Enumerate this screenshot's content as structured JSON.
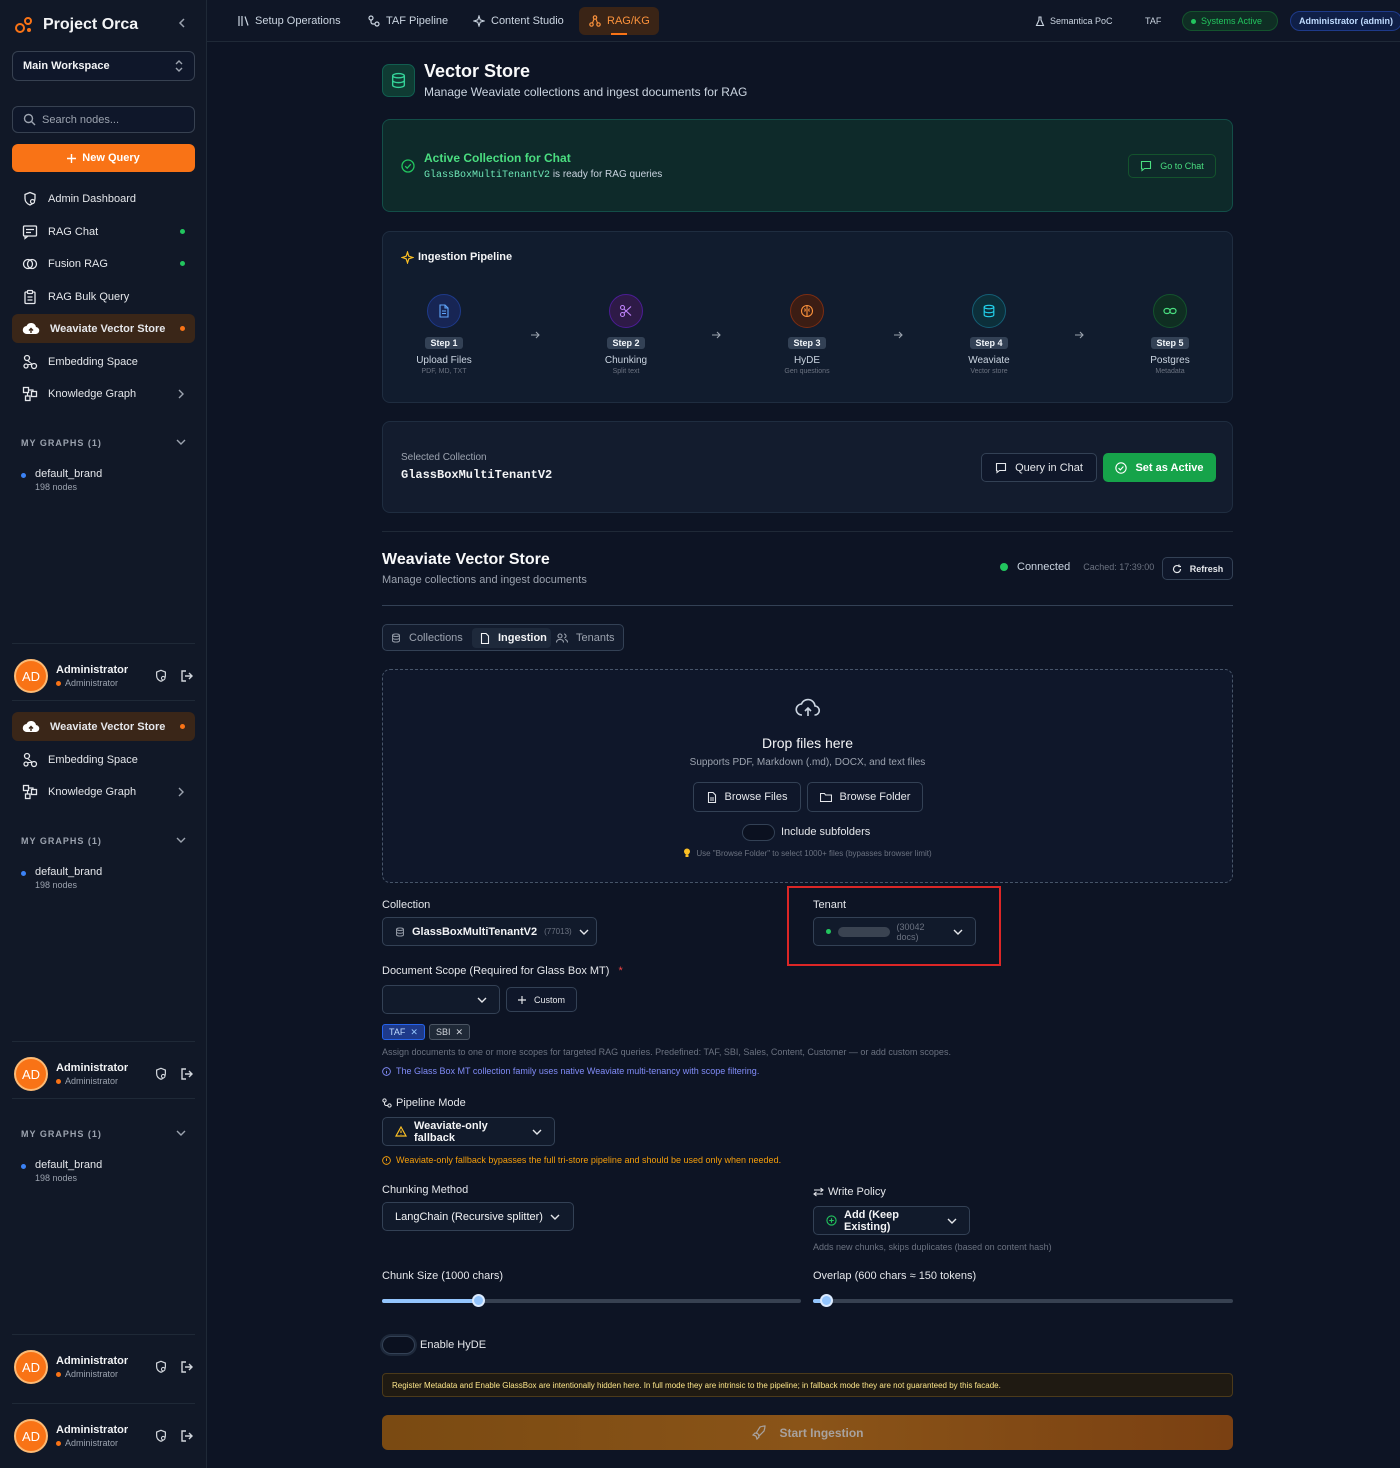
{
  "sidebar": {
    "brand": "Project Orca",
    "workspace": "Main Workspace",
    "search_placeholder": "Search nodes...",
    "new_query": "New Query",
    "nav": [
      "Admin Dashboard",
      "RAG Chat",
      "Fusion RAG",
      "RAG Bulk Query",
      "Weaviate Vector Store",
      "Embedding Space",
      "Knowledge Graph"
    ],
    "my_graphs": "MY GRAPHS (1)",
    "graph": {
      "name": "default_brand",
      "count": "198 nodes"
    },
    "user": {
      "initials": "AD",
      "name": "Administrator",
      "role": "Administrator"
    }
  },
  "topbar": {
    "nav": [
      "Setup Operations",
      "TAF Pipeline",
      "Content Studio",
      "RAG/KG"
    ],
    "right": {
      "project": "Semantica PoC",
      "env": "TAF",
      "status": "Systems Active",
      "user": "Administrator (admin)"
    }
  },
  "header": {
    "title": "Vector Store",
    "subtitle": "Manage Weaviate collections and ingest documents for RAG"
  },
  "active": {
    "title": "Active Collection for Chat",
    "collection": "GlassBoxMultiTenantV2",
    "suffix": "is ready for RAG queries",
    "button": "Go to Chat"
  },
  "pipeline": {
    "title": "Ingestion Pipeline",
    "steps": [
      {
        "badge": "Step 1",
        "name": "Upload Files",
        "sub": "PDF, MD, TXT"
      },
      {
        "badge": "Step 2",
        "name": "Chunking",
        "sub": "Split text"
      },
      {
        "badge": "Step 3",
        "name": "HyDE",
        "sub": "Gen questions"
      },
      {
        "badge": "Step 4",
        "name": "Weaviate",
        "sub": "Vector store"
      },
      {
        "badge": "Step 5",
        "name": "Postgres",
        "sub": "Metadata"
      }
    ]
  },
  "selected": {
    "label": "Selected Collection",
    "name": "GlassBoxMultiTenantV2",
    "query_btn": "Query in Chat",
    "active_btn": "Set as Active"
  },
  "store": {
    "title": "Weaviate Vector Store",
    "subtitle": "Manage collections and ingest documents",
    "status": "Connected",
    "cached": "Cached: 17:39:00",
    "refresh": "Refresh"
  },
  "tabs": [
    "Collections",
    "Ingestion",
    "Tenants"
  ],
  "drop": {
    "title": "Drop files here",
    "sub": "Supports PDF, Markdown (.md), DOCX, and text files",
    "browse_files": "Browse Files",
    "browse_folder": "Browse Folder",
    "subfolders": "Include subfolders",
    "hint": "Use \"Browse Folder\" to select 1000+ files (bypasses browser limit)"
  },
  "collection": {
    "label": "Collection",
    "value": "GlassBoxMultiTenantV2",
    "count": "(77013)"
  },
  "tenant": {
    "label": "Tenant",
    "count": "(30042 docs)"
  },
  "scope": {
    "label": "Document Scope (Required for Glass Box MT)",
    "required": "*",
    "custom": "Custom",
    "tags": [
      "TAF",
      "SBI"
    ],
    "help": "Assign documents to one or more scopes for targeted RAG queries. Predefined: TAF, SBI, Sales, Content, Customer — or add custom scopes.",
    "info": "The Glass Box MT collection family uses native Weaviate multi-tenancy with scope filtering."
  },
  "pipeline_mode": {
    "label": "Pipeline Mode",
    "value": "Weaviate-only fallback",
    "warning": "Weaviate-only fallback bypasses the full tri-store pipeline and should be used only when needed."
  },
  "chunking": {
    "label": "Chunking Method",
    "value": "LangChain (Recursive splitter)"
  },
  "write_policy": {
    "label": "Write Policy",
    "value": "Add (Keep Existing)",
    "help": "Adds new chunks, skips duplicates (based on content hash)"
  },
  "chunk_size": {
    "label": "Chunk Size (1000 chars)",
    "fraction": 0.23
  },
  "overlap": {
    "label": "Overlap (600 chars ≈ 150 tokens)",
    "fraction": 0.03
  },
  "hyde": {
    "label": "Enable HyDE"
  },
  "notice": "Register Metadata and Enable GlassBox are intentionally hidden here. In full mode they are intrinsic to the pipeline; in fallback mode they are not guaranteed by this facade.",
  "start": "Start Ingestion",
  "colors": {
    "accent": "#f97316",
    "success": "#22c55e",
    "info": "#3b82f6",
    "warning": "#f59e0b",
    "highlight": "#dc2626"
  }
}
